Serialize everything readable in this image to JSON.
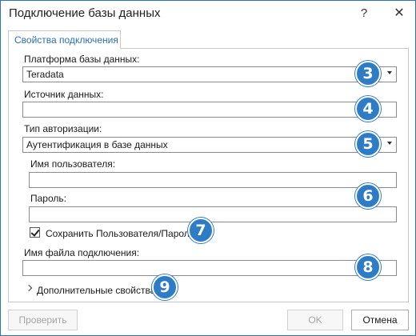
{
  "window": {
    "title": "Подключение базы данных",
    "help_label": "?",
    "close_label": "✕"
  },
  "tab": {
    "label": "Свойства подключения"
  },
  "form": {
    "platform_label": "Платформа базы данных:",
    "platform_value": "Teradata",
    "source_label": "Источник данных:",
    "source_value": "",
    "auth_type_label": "Тип авторизации:",
    "auth_type_value": "Аутентификация в базе данных",
    "username_label": "Имя пользователя:",
    "username_value": "",
    "password_label": "Пароль:",
    "password_value": "",
    "save_credentials_label": "Сохранить Пользователя/Пароль",
    "save_credentials_checked": true,
    "connection_file_label": "Имя файла подключения:",
    "connection_file_value": "",
    "advanced_label": "Дополнительные свойства"
  },
  "badges": {
    "b3": "3",
    "b4": "4",
    "b5": "5",
    "b6": "6",
    "b7": "7",
    "b8": "8",
    "b9": "9"
  },
  "buttons": {
    "validate_label": "Проверить",
    "ok_label": "OK",
    "cancel_label": "Отмена"
  },
  "colors": {
    "accent": "#2b73b8",
    "badge": "#2f7cc6",
    "tab_text": "#2d6fb3"
  }
}
